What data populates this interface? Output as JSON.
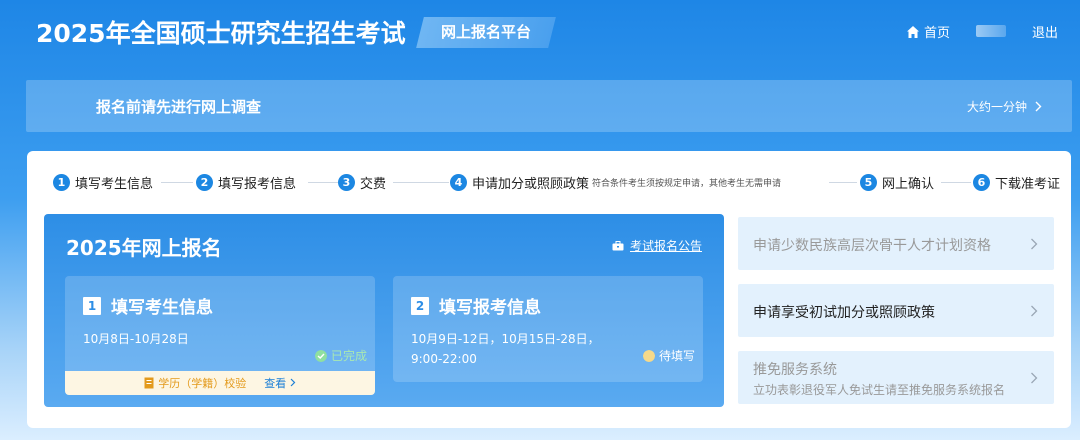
{
  "header": {
    "title": "2025年全国硕士研究生招生考试",
    "platform": "网上报名平台",
    "nav": {
      "home": "首页",
      "logout": "退出"
    }
  },
  "survey": {
    "text": "报名前请先进行网上调查",
    "time": "大约一分钟"
  },
  "steps": [
    {
      "num": "1",
      "label": "填写考生信息"
    },
    {
      "num": "2",
      "label": "填写报考信息"
    },
    {
      "num": "3",
      "label": "交费"
    },
    {
      "num": "4",
      "label": "申请加分或照顾政策",
      "note": "符合条件考生须按规定申请，其他考生无需申请"
    },
    {
      "num": "5",
      "label": "网上确认"
    },
    {
      "num": "6",
      "label": "下载准考证"
    }
  ],
  "registration": {
    "title": "2025年网上报名",
    "notice": "考试报名公告",
    "cards": [
      {
        "num": "1",
        "title": "填写考生信息",
        "date": "10月8日-10月28日",
        "date2": "",
        "status": "已完成",
        "verify": {
          "text": "学历（学籍）校验",
          "view": "查看"
        }
      },
      {
        "num": "2",
        "title": "填写报考信息",
        "date": "10月9日-12日，10月15日-28日，",
        "date2": "9:00-22:00",
        "status": "待填写"
      }
    ]
  },
  "side": [
    {
      "label": "申请少数民族高层次骨干人才计划资格"
    },
    {
      "label": "申请享受初试加分或照顾政策"
    },
    {
      "label": "推免服务系统",
      "sub": "立功表彰退役军人免试生请至推免服务系统报名"
    }
  ],
  "colors": {
    "primary": "#1c87e2",
    "done": "#8fe0a0",
    "pending": "#f6d98a",
    "verify": "#e39a1c"
  }
}
